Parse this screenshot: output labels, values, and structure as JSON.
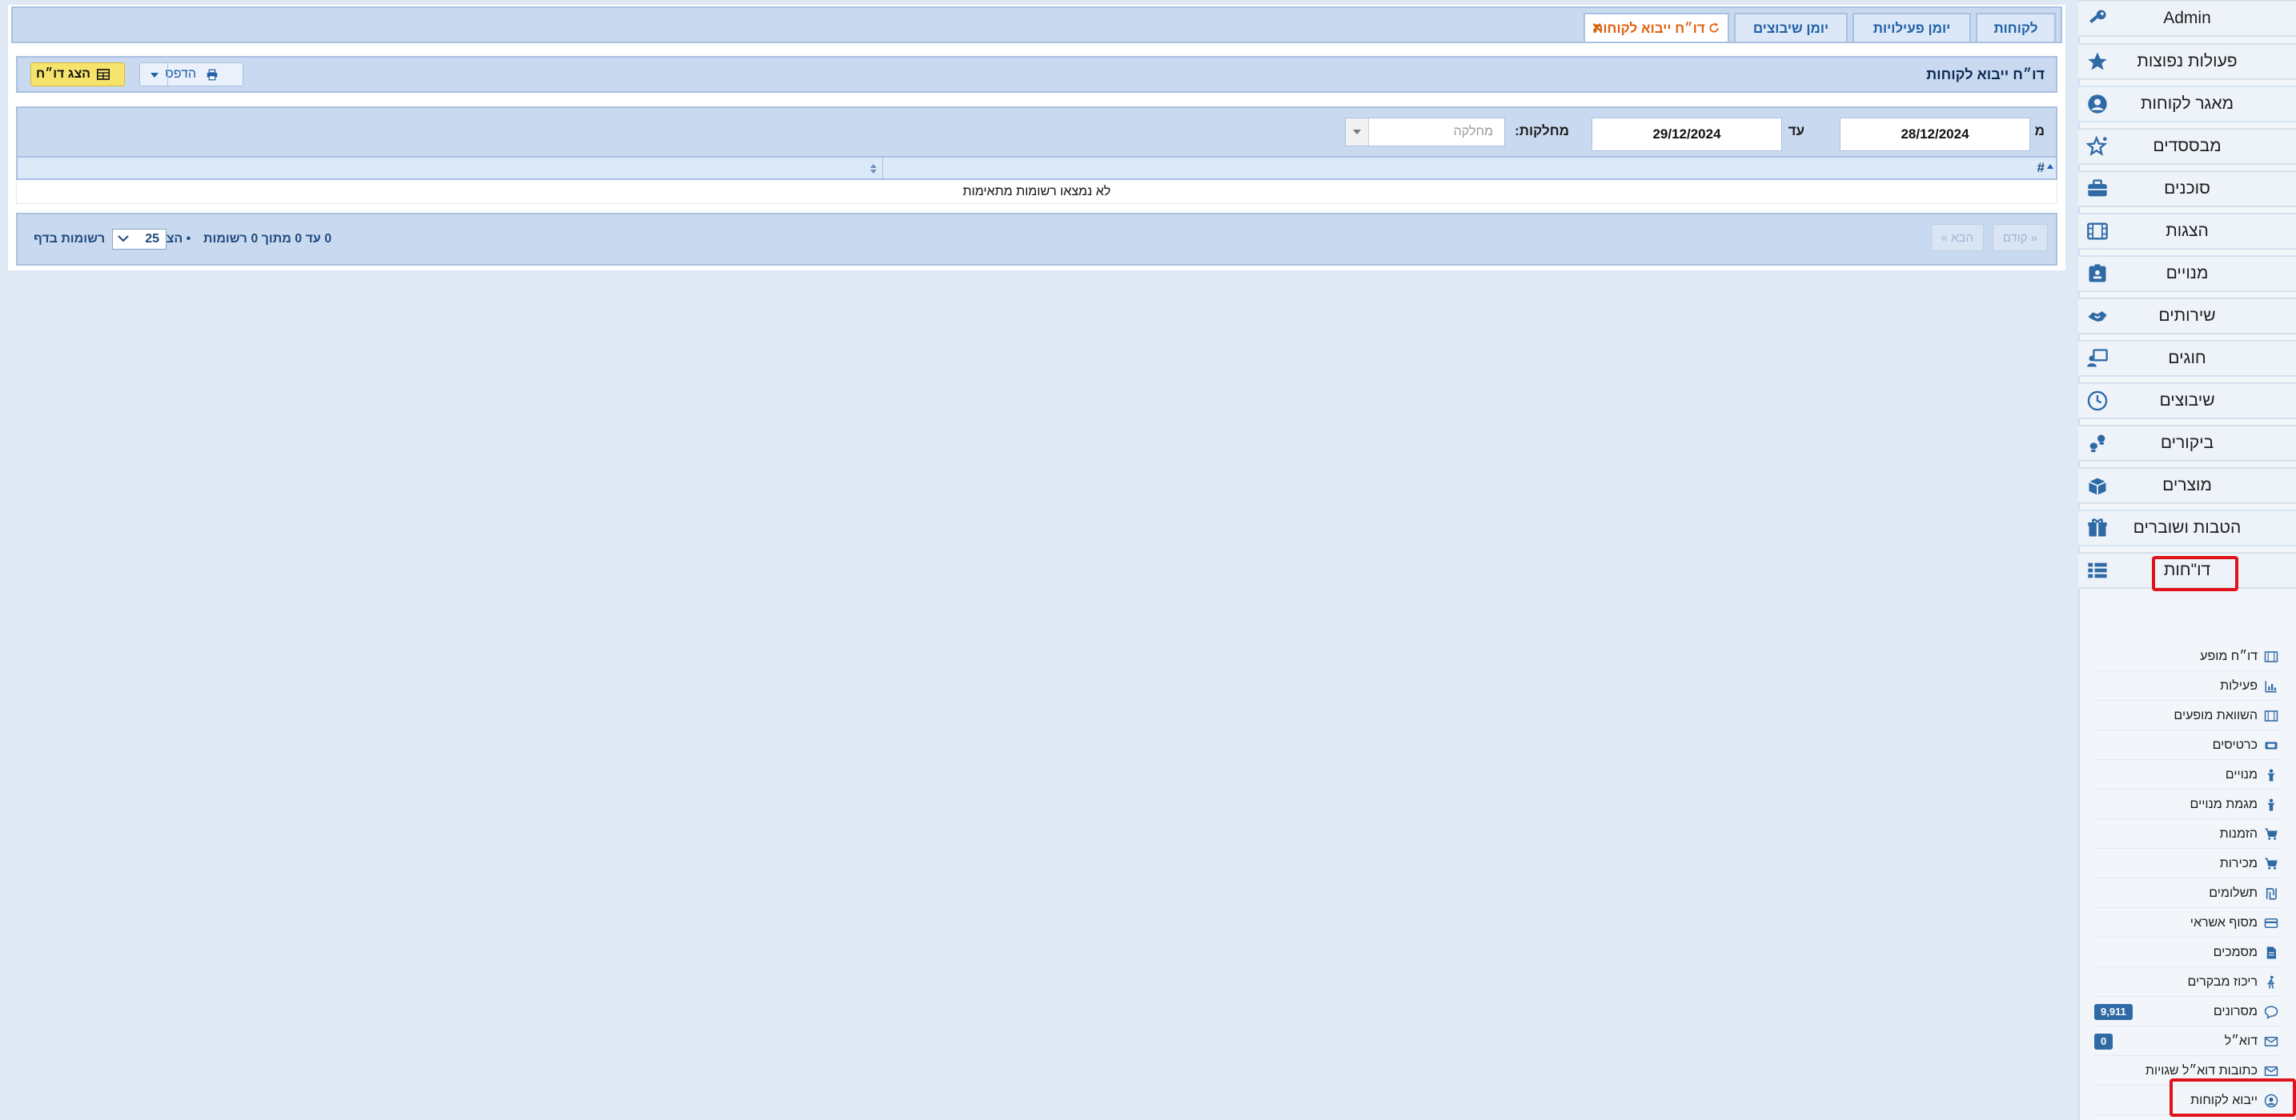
{
  "sidebar": {
    "admin_label": "Admin",
    "items": [
      {
        "label": "פעולות נפוצות",
        "icon": "star-icon"
      },
      {
        "label": "מאגר לקוחות",
        "icon": "user-circle-icon"
      },
      {
        "label": "מבססדים",
        "icon": "star-sparkle-icon"
      },
      {
        "label": "סוכנים",
        "icon": "briefcase-icon"
      },
      {
        "label": "הצגות",
        "icon": "film-icon"
      },
      {
        "label": "מנויים",
        "icon": "id-card-icon"
      },
      {
        "label": "שירותים",
        "icon": "handshake-icon"
      },
      {
        "label": "חוגים",
        "icon": "teacher-board-icon"
      },
      {
        "label": "שיבוצים",
        "icon": "clock-icon"
      },
      {
        "label": "ביקורים",
        "icon": "footsteps-icon"
      },
      {
        "label": "מוצרים",
        "icon": "box-icon"
      },
      {
        "label": "הטבות ושוברים",
        "icon": "gift-icon"
      },
      {
        "label": "דו\"חות",
        "icon": "list-table-icon"
      }
    ],
    "reports_submenu": [
      {
        "label": "דו״ח מופע",
        "icon": "film-icon"
      },
      {
        "label": "פעילות",
        "icon": "chart-icon"
      },
      {
        "label": "השוואת מופעים",
        "icon": "film-icon"
      },
      {
        "label": "כרטיסים",
        "icon": "ticket-icon"
      },
      {
        "label": "מנויים",
        "icon": "person-icon"
      },
      {
        "label": "מגמת מנויים",
        "icon": "person-icon"
      },
      {
        "label": "הזמנות",
        "icon": "cart-icon"
      },
      {
        "label": "מכירות",
        "icon": "cart-icon"
      },
      {
        "label": "תשלומים",
        "icon": "shekel-icon"
      },
      {
        "label": "מסוף אשראי",
        "icon": "credit-card-icon"
      },
      {
        "label": "מסמכים",
        "icon": "document-icon"
      },
      {
        "label": "ריכוז מבקרים",
        "icon": "walking-icon"
      },
      {
        "label": "מסרונים",
        "icon": "comment-icon",
        "badge": "9,911"
      },
      {
        "label": "דוא״ל",
        "icon": "envelope-icon",
        "badge": "0"
      },
      {
        "label": "כתובות דוא״ל שגויות",
        "icon": "envelope-icon"
      },
      {
        "label": "ייבוא לקוחות",
        "icon": "user-circle-icon"
      }
    ]
  },
  "tabs": [
    {
      "label": "לקוחות"
    },
    {
      "label": "יומן פעילויות"
    },
    {
      "label": "יומן שיבוצים"
    },
    {
      "label": "דו״ח ייבוא לקוחות",
      "active": true
    }
  ],
  "report": {
    "title": "דו״ח ייבוא לקוחות",
    "show_report_label": "הצג דו״ח",
    "print_label": "הדפס"
  },
  "filters": {
    "from_label": "מ",
    "from_value": "28/12/2024",
    "to_label": "עד",
    "to_value": "29/12/2024",
    "dept_label": "מחלקות:",
    "dept_placeholder": "מחלקה"
  },
  "grid": {
    "col_hash": "#",
    "empty_message": "לא נמצאו רשומות מתאימות"
  },
  "pager": {
    "prev_label": "« קודם",
    "next_label": "הבא »",
    "info": "0 עד 0 מתוך 0 רשומות",
    "show_label": "• הצג",
    "page_size": "25",
    "per_page_label": "רשומות בדף"
  },
  "colors": {
    "background": "#dfe8f5",
    "panel": "#c9daf0",
    "accent_link": "#2060a8",
    "active_tab": "#e0620f",
    "primary_button": "#f6e36b",
    "highlight_box": "#e0131b",
    "badge": "#2f6aa5"
  }
}
